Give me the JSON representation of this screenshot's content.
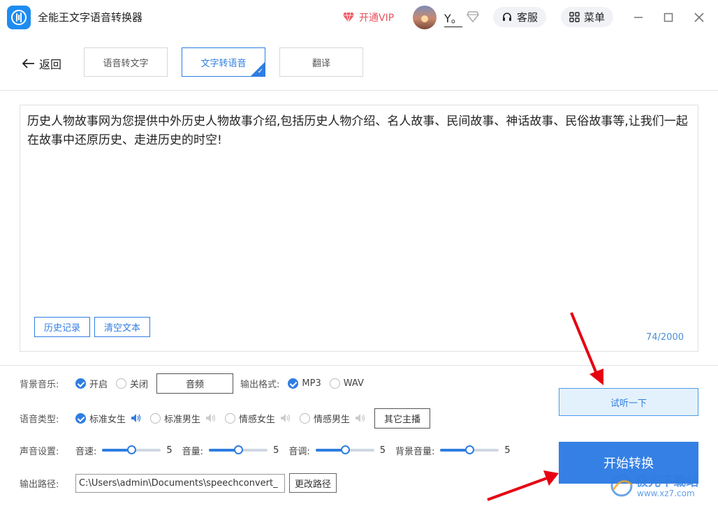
{
  "app": {
    "title": "全能王文字语音转换器"
  },
  "titlebar": {
    "vip_label": "开通VIP",
    "username": "Y。",
    "service_label": "客服",
    "menu_label": "菜单"
  },
  "nav": {
    "back_label": "返回",
    "tabs": [
      {
        "label": "语音转文字",
        "active": false
      },
      {
        "label": "文字转语音",
        "active": true
      },
      {
        "label": "翻译",
        "active": false
      }
    ]
  },
  "editor": {
    "text": "历史人物故事网为您提供中外历史人物故事介绍,包括历史人物介绍、名人故事、民间故事、神话故事、民俗故事等,让我们一起在故事中还原历史、走进历史的时空!",
    "history_label": "历史记录",
    "clear_label": "清空文本",
    "counter": "74/2000"
  },
  "settings": {
    "bgm": {
      "label": "背景音乐:",
      "on_label": "开启",
      "off_label": "关闭",
      "value": "on",
      "audio_button": "音频"
    },
    "format": {
      "label": "输出格式:",
      "options": [
        "MP3",
        "WAV"
      ],
      "value": "MP3"
    },
    "voice": {
      "label": "语音类型:",
      "options": [
        "标准女生",
        "标准男生",
        "情感女生",
        "情感男生"
      ],
      "value": "标准女生",
      "more_button": "其它主播"
    },
    "sound": {
      "label": "声音设置:",
      "sliders": [
        {
          "label": "音速:",
          "value": 5,
          "max": 10
        },
        {
          "label": "音量:",
          "value": 5,
          "max": 10
        },
        {
          "label": "音调:",
          "value": 5,
          "max": 10
        },
        {
          "label": "背景音量:",
          "value": 5,
          "max": 10
        }
      ]
    },
    "output": {
      "label": "输出路径:",
      "path": "C:\\Users\\admin\\Documents\\speechconvert_",
      "change_button": "更改路径"
    }
  },
  "actions": {
    "preview_label": "试听一下",
    "start_label": "开始转换"
  },
  "watermark": {
    "text": "极光下载站",
    "url": "www.xz7.com"
  },
  "colors": {
    "accent": "#3480e4",
    "vip": "#e8505b",
    "annotation_arrow": "#e60012"
  }
}
